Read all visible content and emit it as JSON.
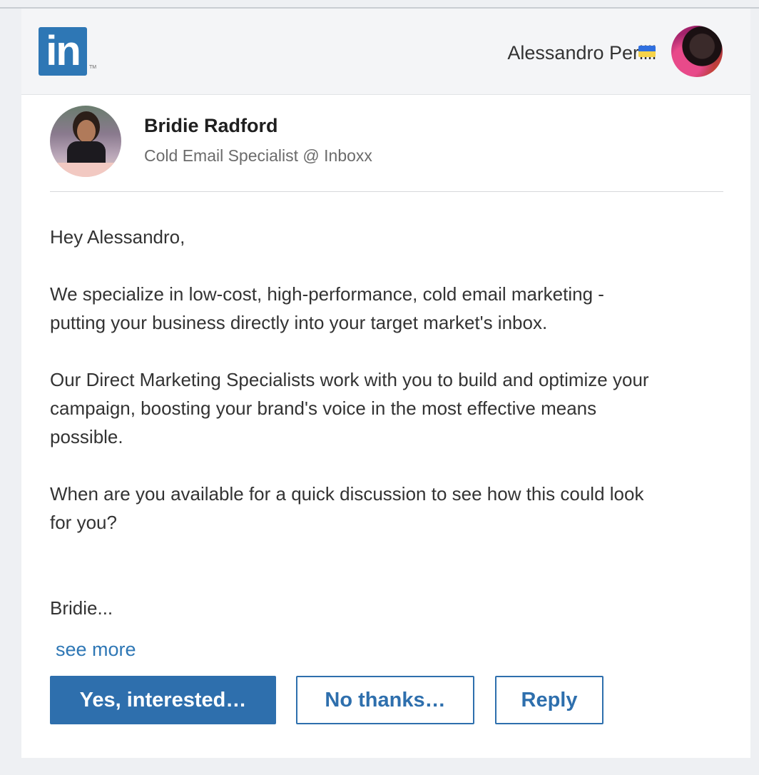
{
  "header": {
    "logo_text": "in",
    "logo_trademark": "TM",
    "user_name": "Alessandro Perilli",
    "user_flag": "ukraine-flag-icon",
    "avatar": "user-avatar"
  },
  "sender": {
    "name": "Bridie Radford",
    "title": "Cold Email Specialist @ Inboxx"
  },
  "message": {
    "greeting": "Hey Alessandro,",
    "p1_line1": "We specialize in low-cost, high-performance, cold email marketing -",
    "p1_line2": "putting your business directly into your target market's inbox.",
    "p2_line1": "Our Direct Marketing Specialists work with you to build and optimize your",
    "p2_line2": "campaign, boosting your brand's voice in the most effective means",
    "p2_line3": "possible.",
    "p3_line1": "When are you available for a quick discussion to see how this could look",
    "p3_line2": "for you?",
    "signature": "Bridie...",
    "see_more": "see more"
  },
  "actions": {
    "yes_label": "Yes, interested…",
    "no_label": "No thanks…",
    "reply_label": "Reply"
  },
  "colors": {
    "accent": "#2e6fad",
    "linkedin_blue": "#2e77b5",
    "page_bg": "#eef0f3"
  }
}
